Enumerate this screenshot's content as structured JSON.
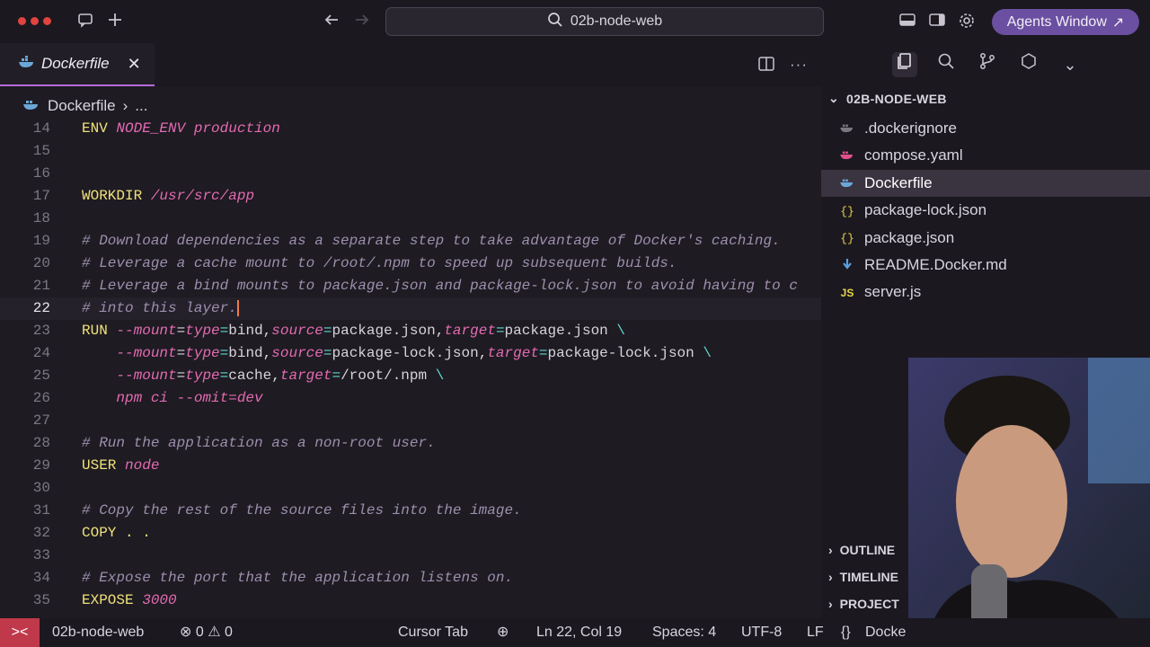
{
  "titlebar": {
    "search_text": "02b-node-web",
    "agents_button": "Agents Window",
    "agents_arrow": "↗"
  },
  "tab": {
    "name": "Dockerfile"
  },
  "breadcrumb": {
    "file": "Dockerfile",
    "more": "..."
  },
  "editor": {
    "lines": [
      {
        "n": "14",
        "text": "ENV NODE_ENV production"
      },
      {
        "n": "15",
        "text": ""
      },
      {
        "n": "16",
        "text": ""
      },
      {
        "n": "17",
        "text": "WORKDIR /usr/src/app"
      },
      {
        "n": "18",
        "text": ""
      },
      {
        "n": "19",
        "text": "# Download dependencies as a separate step to take advantage of Docker's caching."
      },
      {
        "n": "20",
        "text": "# Leverage a cache mount to /root/.npm to speed up subsequent builds."
      },
      {
        "n": "21",
        "text": "# Leverage a bind mounts to package.json and package-lock.json to avoid having to c"
      },
      {
        "n": "22",
        "text": "# into this layer."
      },
      {
        "n": "23",
        "text": "RUN --mount=type=bind,source=package.json,target=package.json \\"
      },
      {
        "n": "24",
        "text": "    --mount=type=bind,source=package-lock.json,target=package-lock.json \\"
      },
      {
        "n": "25",
        "text": "    --mount=type=cache,target=/root/.npm \\"
      },
      {
        "n": "26",
        "text": "    npm ci --omit=dev"
      },
      {
        "n": "27",
        "text": ""
      },
      {
        "n": "28",
        "text": "# Run the application as a non-root user."
      },
      {
        "n": "29",
        "text": "USER node"
      },
      {
        "n": "30",
        "text": ""
      },
      {
        "n": "31",
        "text": "# Copy the rest of the source files into the image."
      },
      {
        "n": "32",
        "text": "COPY . ."
      },
      {
        "n": "33",
        "text": ""
      },
      {
        "n": "34",
        "text": "# Expose the port that the application listens on."
      },
      {
        "n": "35",
        "text": "EXPOSE 3000"
      }
    ],
    "active_line": "22"
  },
  "explorer": {
    "title": "02B-NODE-WEB",
    "files": [
      {
        "name": ".dockerignore",
        "icon": "docker-gray-icon"
      },
      {
        "name": "compose.yaml",
        "icon": "docker-pink-icon"
      },
      {
        "name": "Dockerfile",
        "icon": "docker-blue-icon",
        "selected": true
      },
      {
        "name": "package-lock.json",
        "icon": "json-icon"
      },
      {
        "name": "package.json",
        "icon": "json-icon"
      },
      {
        "name": "README.Docker.md",
        "icon": "markdown-icon"
      },
      {
        "name": "server.js",
        "icon": "js-icon"
      }
    ],
    "sections": [
      "OUTLINE",
      "TIMELINE",
      "PROJECT"
    ]
  },
  "statusbar": {
    "remote": "><",
    "workspace": "02b-node-web",
    "errors": "0",
    "warnings": "0",
    "cursor_tab": "Cursor Tab",
    "position": "Ln 22, Col 19",
    "spaces": "Spaces: 4",
    "encoding": "UTF-8",
    "eol": "LF",
    "language": "Docke"
  },
  "colors": {
    "accent": "#6b4fa0",
    "keyword": "#f0e27a",
    "comment": "#9d8fae",
    "italic_value": "#e36bb2",
    "remote_bg": "#c0394b"
  }
}
